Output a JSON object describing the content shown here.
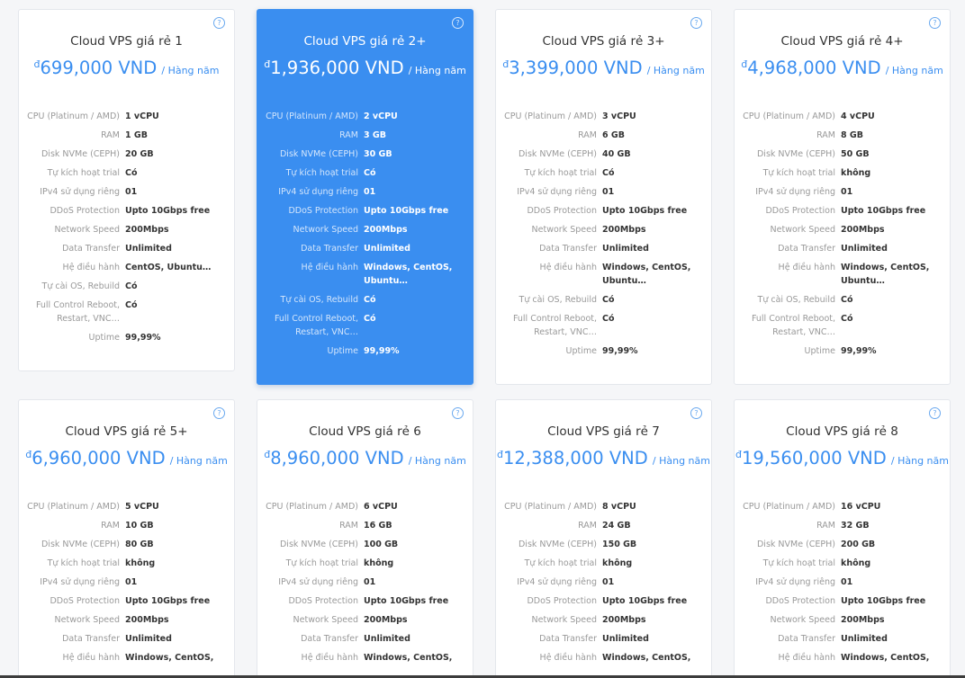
{
  "plans": [
    {
      "help": "?",
      "title": "Cloud VPS giá rẻ 1",
      "currency": "đ",
      "price": "699,000 VND",
      "period": "/ Hàng năm",
      "specs": [
        {
          "label": "CPU (Platinum / AMD)",
          "value": "1 vCPU"
        },
        {
          "label": "RAM",
          "value": "1 GB"
        },
        {
          "label": "Disk NVMe (CEPH)",
          "value": "20 GB"
        },
        {
          "label": "Tự kích hoạt trial",
          "value": "Có"
        },
        {
          "label": "IPv4 sử dụng riêng",
          "value": "01"
        },
        {
          "label": "DDoS Protection",
          "value": "Upto 10Gbps free"
        },
        {
          "label": "Network Speed",
          "value": "200Mbps"
        },
        {
          "label": "Data Transfer",
          "value": "Unlimited"
        },
        {
          "label": "Hệ điều hành",
          "value": "CentOS, Ubuntu…"
        },
        {
          "label": "Tự cài OS, Rebuild",
          "value": "Có"
        },
        {
          "label": "Full Control Reboot, Restart, VNC…",
          "value": "Có"
        },
        {
          "label": "Uptime",
          "value": "99,99%"
        }
      ]
    },
    {
      "help": "?",
      "title": "Cloud VPS giá rẻ 2+",
      "currency": "đ",
      "price": "1,936,000 VND",
      "period": "/ Hàng năm",
      "specs": [
        {
          "label": "CPU (Platinum / AMD)",
          "value": "2 vCPU"
        },
        {
          "label": "RAM",
          "value": "3 GB"
        },
        {
          "label": "Disk NVMe (CEPH)",
          "value": "30 GB"
        },
        {
          "label": "Tự kích hoạt trial",
          "value": "Có"
        },
        {
          "label": "IPv4 sử dụng riêng",
          "value": "01"
        },
        {
          "label": "DDoS Protection",
          "value": "Upto 10Gbps free"
        },
        {
          "label": "Network Speed",
          "value": "200Mbps"
        },
        {
          "label": "Data Transfer",
          "value": "Unlimited"
        },
        {
          "label": "Hệ điều hành",
          "value": "Windows, CentOS, Ubuntu…"
        },
        {
          "label": "Tự cài OS, Rebuild",
          "value": "Có"
        },
        {
          "label": "Full Control Reboot, Restart, VNC…",
          "value": "Có"
        },
        {
          "label": "Uptime",
          "value": "99,99%"
        }
      ]
    },
    {
      "help": "?",
      "title": "Cloud VPS giá rẻ 3+",
      "currency": "đ",
      "price": "3,399,000 VND",
      "period": "/ Hàng năm",
      "specs": [
        {
          "label": "CPU (Platinum / AMD)",
          "value": "3 vCPU"
        },
        {
          "label": "RAM",
          "value": "6 GB"
        },
        {
          "label": "Disk NVMe (CEPH)",
          "value": "40 GB"
        },
        {
          "label": "Tự kích hoạt trial",
          "value": "Có"
        },
        {
          "label": "IPv4 sử dụng riêng",
          "value": "01"
        },
        {
          "label": "DDoS Protection",
          "value": "Upto 10Gbps free"
        },
        {
          "label": "Network Speed",
          "value": "200Mbps"
        },
        {
          "label": "Data Transfer",
          "value": "Unlimited"
        },
        {
          "label": "Hệ điều hành",
          "value": "Windows, CentOS, Ubuntu…"
        },
        {
          "label": "Tự cài OS, Rebuild",
          "value": "Có"
        },
        {
          "label": "Full Control Reboot, Restart, VNC…",
          "value": "Có"
        },
        {
          "label": "Uptime",
          "value": "99,99%"
        }
      ]
    },
    {
      "help": "?",
      "title": "Cloud VPS giá rẻ 4+",
      "currency": "đ",
      "price": "4,968,000 VND",
      "period": "/ Hàng năm",
      "specs": [
        {
          "label": "CPU (Platinum / AMD)",
          "value": "4 vCPU"
        },
        {
          "label": "RAM",
          "value": "8 GB"
        },
        {
          "label": "Disk NVMe (CEPH)",
          "value": "50 GB"
        },
        {
          "label": "Tự kích hoạt trial",
          "value": "không"
        },
        {
          "label": "IPv4 sử dụng riêng",
          "value": "01"
        },
        {
          "label": "DDoS Protection",
          "value": "Upto 10Gbps free"
        },
        {
          "label": "Network Speed",
          "value": "200Mbps"
        },
        {
          "label": "Data Transfer",
          "value": "Unlimited"
        },
        {
          "label": "Hệ điều hành",
          "value": "Windows, CentOS, Ubuntu…"
        },
        {
          "label": "Tự cài OS, Rebuild",
          "value": "Có"
        },
        {
          "label": "Full Control Reboot, Restart, VNC…",
          "value": "Có"
        },
        {
          "label": "Uptime",
          "value": "99,99%"
        }
      ]
    },
    {
      "help": "?",
      "title": "Cloud VPS giá rẻ 5+",
      "currency": "đ",
      "price": "6,960,000 VND",
      "period": "/ Hàng năm",
      "specs": [
        {
          "label": "CPU (Platinum / AMD)",
          "value": "5 vCPU"
        },
        {
          "label": "RAM",
          "value": "10 GB"
        },
        {
          "label": "Disk NVMe (CEPH)",
          "value": "80 GB"
        },
        {
          "label": "Tự kích hoạt trial",
          "value": "không"
        },
        {
          "label": "IPv4 sử dụng riêng",
          "value": "01"
        },
        {
          "label": "DDoS Protection",
          "value": "Upto 10Gbps free"
        },
        {
          "label": "Network Speed",
          "value": "200Mbps"
        },
        {
          "label": "Data Transfer",
          "value": "Unlimited"
        },
        {
          "label": "Hệ điều hành",
          "value": "Windows, CentOS,"
        }
      ]
    },
    {
      "help": "?",
      "title": "Cloud VPS giá rẻ 6",
      "currency": "đ",
      "price": "8,960,000 VND",
      "period": "/ Hàng năm",
      "specs": [
        {
          "label": "CPU (Platinum / AMD)",
          "value": "6 vCPU"
        },
        {
          "label": "RAM",
          "value": "16 GB"
        },
        {
          "label": "Disk NVMe (CEPH)",
          "value": "100 GB"
        },
        {
          "label": "Tự kích hoạt trial",
          "value": "không"
        },
        {
          "label": "IPv4 sử dụng riêng",
          "value": "01"
        },
        {
          "label": "DDoS Protection",
          "value": "Upto 10Gbps free"
        },
        {
          "label": "Network Speed",
          "value": "200Mbps"
        },
        {
          "label": "Data Transfer",
          "value": "Unlimited"
        },
        {
          "label": "Hệ điều hành",
          "value": "Windows, CentOS,"
        }
      ]
    },
    {
      "help": "?",
      "title": "Cloud VPS giá rẻ 7",
      "currency": "đ",
      "price": "12,388,000 VND",
      "period": "/ Hàng năm",
      "specs": [
        {
          "label": "CPU (Platinum / AMD)",
          "value": "8 vCPU"
        },
        {
          "label": "RAM",
          "value": "24 GB"
        },
        {
          "label": "Disk NVMe (CEPH)",
          "value": "150 GB"
        },
        {
          "label": "Tự kích hoạt trial",
          "value": "không"
        },
        {
          "label": "IPv4 sử dụng riêng",
          "value": "01"
        },
        {
          "label": "DDoS Protection",
          "value": "Upto 10Gbps free"
        },
        {
          "label": "Network Speed",
          "value": "200Mbps"
        },
        {
          "label": "Data Transfer",
          "value": "Unlimited"
        },
        {
          "label": "Hệ điều hành",
          "value": "Windows, CentOS,"
        }
      ]
    },
    {
      "help": "?",
      "title": "Cloud VPS giá rẻ 8",
      "currency": "đ",
      "price": "19,560,000 VND",
      "period": "/ Hàng năm",
      "specs": [
        {
          "label": "CPU (Platinum / AMD)",
          "value": "16 vCPU"
        },
        {
          "label": "RAM",
          "value": "32 GB"
        },
        {
          "label": "Disk NVMe (CEPH)",
          "value": "200 GB"
        },
        {
          "label": "Tự kích hoạt trial",
          "value": "không"
        },
        {
          "label": "IPv4 sử dụng riêng",
          "value": "01"
        },
        {
          "label": "DDoS Protection",
          "value": "Upto 10Gbps free"
        },
        {
          "label": "Network Speed",
          "value": "200Mbps"
        },
        {
          "label": "Data Transfer",
          "value": "Unlimited"
        },
        {
          "label": "Hệ điều hành",
          "value": "Windows, CentOS,"
        }
      ]
    }
  ],
  "colors": {
    "accent": "#3a8ef0",
    "label": "#999999",
    "value": "#333333",
    "card_border": "#e4e7ec"
  }
}
